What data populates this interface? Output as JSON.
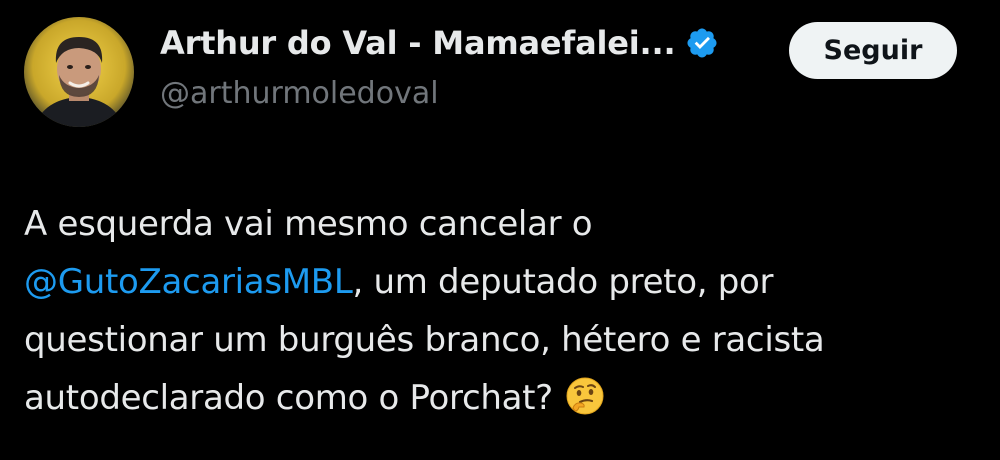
{
  "author": {
    "display_name": "Arthur do Val - Mamaefalei...",
    "handle": "@arthurmoledoval",
    "verified": true,
    "avatar_icon": "user-avatar"
  },
  "follow_button": {
    "label": "Seguir"
  },
  "tweet": {
    "line1": "A esquerda vai mesmo cancelar o",
    "mention": "@GutoZacariasMBL",
    "line2_rest": ", um deputado preto, por",
    "line3": "questionar um burguês branco, hétero e racista",
    "line4": "autodeclarado como o Porchat?",
    "emoji_icon": "thinking-face-emoji"
  },
  "colors": {
    "background": "#000000",
    "text": "#e7e9ea",
    "secondary_text": "#71767b",
    "link": "#1d9bf0",
    "verified_badge": "#1d9bf0",
    "button_bg": "#eff3f4"
  }
}
